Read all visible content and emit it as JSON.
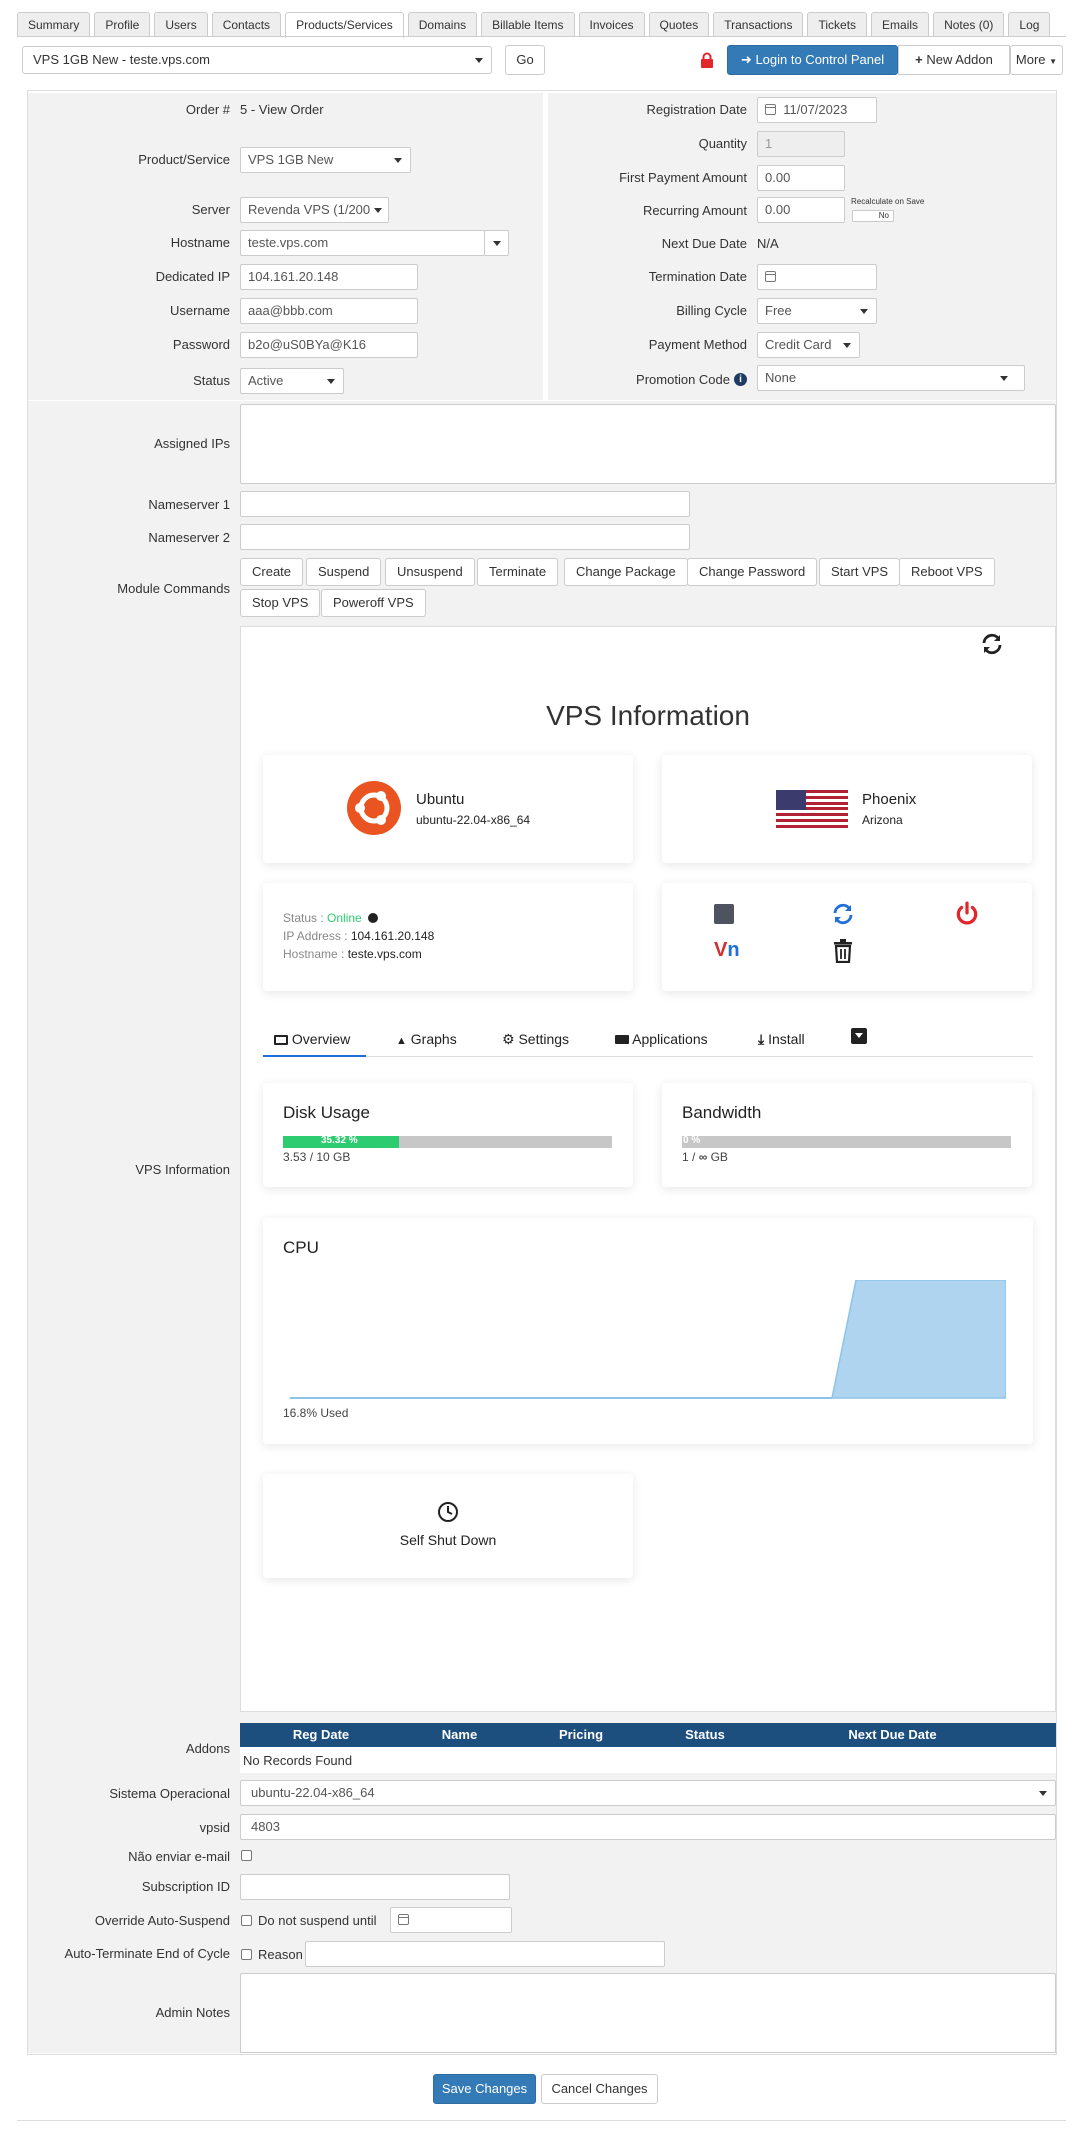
{
  "tabs": [
    "Summary",
    "Profile",
    "Users",
    "Contacts",
    "Products/Services",
    "Domains",
    "Billable Items",
    "Invoices",
    "Quotes",
    "Transactions",
    "Tickets",
    "Emails",
    "Notes (0)",
    "Log"
  ],
  "active_tab": "Products/Services",
  "header": {
    "service_select": "VPS 1GB New - teste.vps.com",
    "go": "Go",
    "login_cp": "Login to Control Panel",
    "new_addon": "New Addon",
    "more": "More"
  },
  "fields": {
    "order_label": "Order #",
    "order_value": "5 - View Order",
    "product_label": "Product/Service",
    "product_value": "VPS 1GB New",
    "server_label": "Server",
    "server_value": "Revenda VPS (1/200",
    "hostname_label": "Hostname",
    "hostname_value": "teste.vps.com",
    "dedicated_ip_label": "Dedicated IP",
    "dedicated_ip_value": "104.161.20.148",
    "username_label": "Username",
    "username_value": "aaa@bbb.com",
    "password_label": "Password",
    "password_value": "b2o@uS0BYa@K16",
    "status_label": "Status",
    "status_value": "Active",
    "reg_date_label": "Registration Date",
    "reg_date_value": "11/07/2023",
    "quantity_label": "Quantity",
    "quantity_value": "1",
    "first_payment_label": "First Payment Amount",
    "first_payment_value": "0.00",
    "recurring_label": "Recurring Amount",
    "recurring_value": "0.00",
    "recalc_label": "Recalculate on Save",
    "recalc_toggle": "No",
    "next_due_label": "Next Due Date",
    "next_due_value": "N/A",
    "termination_label": "Termination Date",
    "billing_cycle_label": "Billing Cycle",
    "billing_cycle_value": "Free",
    "payment_method_label": "Payment Method",
    "payment_method_value": "Credit Card",
    "promo_label": "Promotion Code",
    "promo_value": "None",
    "assigned_ips_label": "Assigned IPs",
    "ns1_label": "Nameserver 1",
    "ns2_label": "Nameserver 2",
    "module_label": "Module Commands",
    "vps_info_label": "VPS Information",
    "addons_label": "Addons",
    "so_label": "Sistema Operacional",
    "so_value": "ubuntu-22.04-x86_64",
    "vpsid_label": "vpsid",
    "vpsid_value": "4803",
    "no_email_label": "Não enviar e-mail",
    "subscription_label": "Subscription ID",
    "override_label": "Override Auto-Suspend",
    "override_text": "Do not suspend until",
    "autoterm_label": "Auto-Terminate End of Cycle",
    "autoterm_text": "Reason",
    "admin_notes_label": "Admin Notes"
  },
  "module_commands": [
    "Create",
    "Suspend",
    "Unsuspend",
    "Terminate",
    "Change Package",
    "Change Password",
    "Start VPS",
    "Reboot VPS",
    "Stop VPS",
    "Poweroff VPS"
  ],
  "vps": {
    "title": "VPS Information",
    "os_name": "Ubuntu",
    "os_version": "ubuntu-22.04-x86_64",
    "location_city": "Phoenix",
    "location_state": "Arizona",
    "status_label": "Status : ",
    "status_value": "Online",
    "ip_label": "IP Address : ",
    "ip_value": "104.161.20.148",
    "host_label": "Hostname : ",
    "host_value": "teste.vps.com",
    "tabs": [
      "Overview",
      "Graphs",
      "Settings",
      "Applications",
      "Install"
    ],
    "disk_title": "Disk Usage",
    "disk_percent": "35.32 %",
    "disk_fraction": 0.3532,
    "disk_text": "3.53 / 10 GB",
    "bw_title": "Bandwidth",
    "bw_percent": "0 %",
    "bw_text_a": "1 / ",
    "bw_text_b": "GB",
    "cpu_title": "CPU",
    "cpu_used": "16.8% Used",
    "shutdown": "Self Shut Down",
    "colors": {
      "online": "#2ecc71",
      "stop": "#4f5360",
      "refresh": "#1e6fd9",
      "power": "#e3262a",
      "disk_bar": "#2ecc71",
      "cpu_fill": "#afd4ef"
    }
  },
  "addons_table": {
    "headers": [
      "Reg Date",
      "Name",
      "Pricing",
      "Status",
      "Next Due Date"
    ],
    "empty": "No Records Found"
  },
  "footer": {
    "save": "Save Changes",
    "cancel": "Cancel Changes"
  }
}
